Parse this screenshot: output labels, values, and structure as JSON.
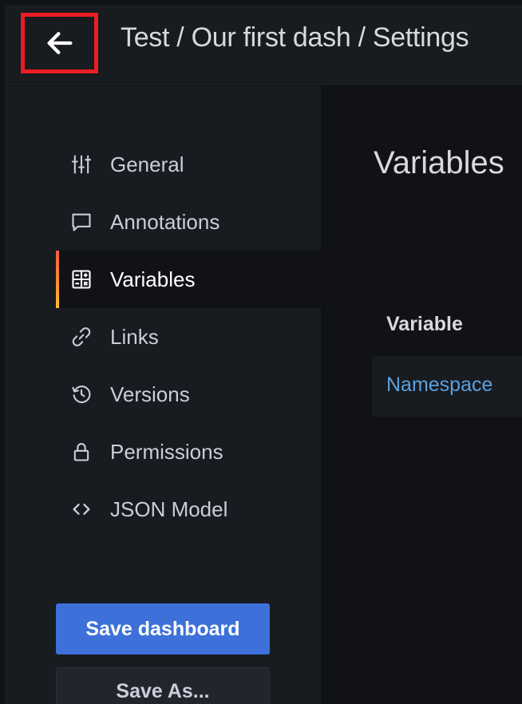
{
  "header": {
    "breadcrumb": "Test / Our first dash / Settings",
    "back_icon": "arrow-left-icon"
  },
  "sidebar": {
    "items": [
      {
        "label": "General",
        "icon": "sliders-icon",
        "active": false
      },
      {
        "label": "Annotations",
        "icon": "comment-icon",
        "active": false
      },
      {
        "label": "Variables",
        "icon": "calculator-icon",
        "active": true
      },
      {
        "label": "Links",
        "icon": "link-icon",
        "active": false
      },
      {
        "label": "Versions",
        "icon": "history-icon",
        "active": false
      },
      {
        "label": "Permissions",
        "icon": "lock-icon",
        "active": false
      },
      {
        "label": "JSON Model",
        "icon": "code-brackets-icon",
        "active": false
      }
    ],
    "save_label": "Save dashboard",
    "save_as_label": "Save As..."
  },
  "main": {
    "title": "Variables",
    "table": {
      "column_header": "Variable",
      "rows": [
        {
          "name": "Namespace"
        }
      ]
    }
  },
  "colors": {
    "background": "#111217",
    "panel": "#181b1f",
    "primary": "#3d71d9",
    "link": "#5ba0e0",
    "highlight": "#ec1c24"
  }
}
